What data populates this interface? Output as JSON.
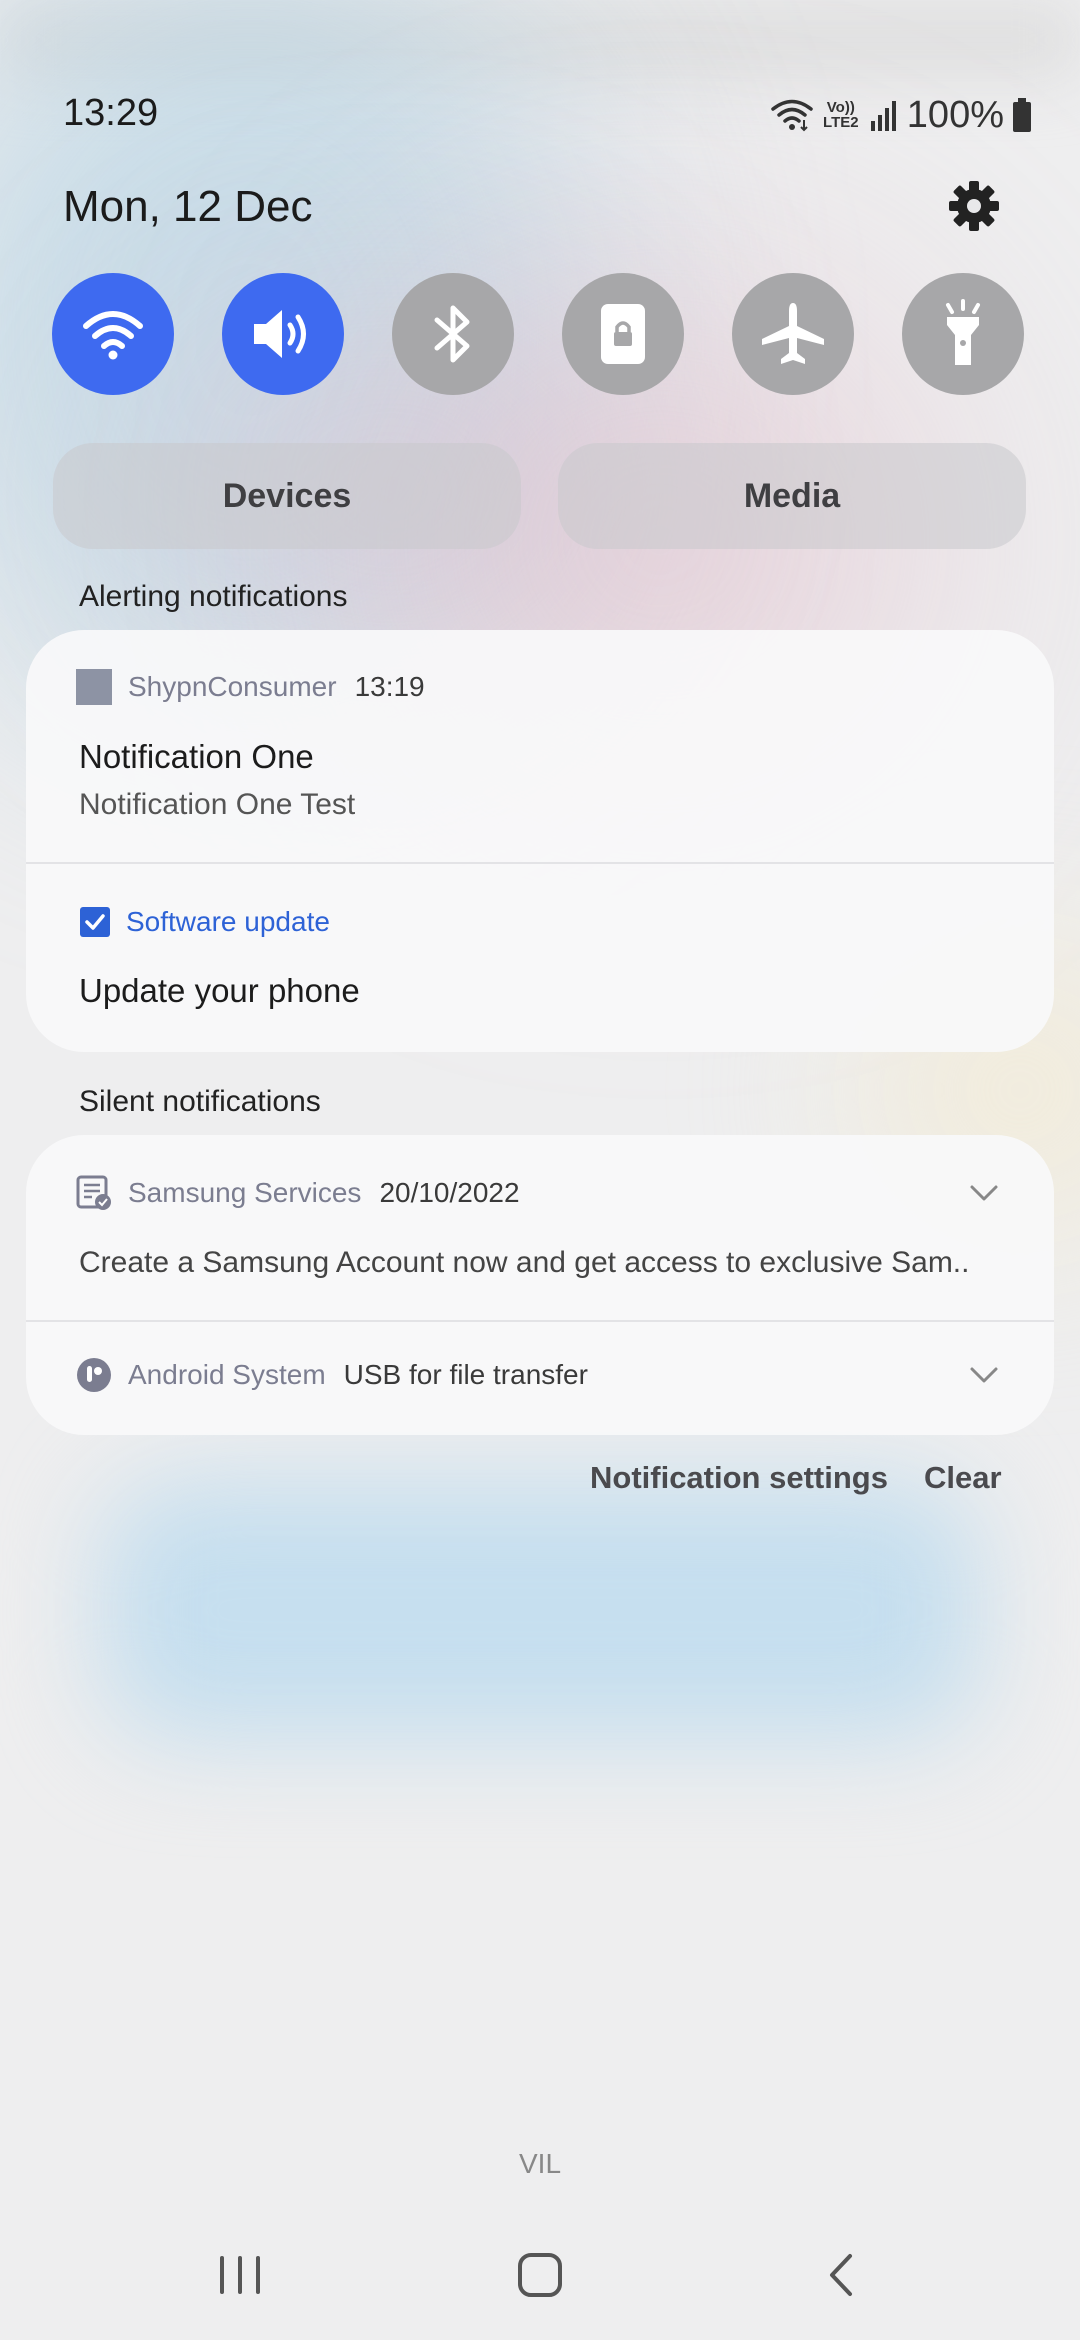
{
  "status_bar": {
    "time": "13:29",
    "battery": "100%",
    "volte_label": "Vo)) LTE2",
    "icons": [
      "wifi-icon",
      "volte-icon",
      "signal-bars-icon",
      "battery-icon"
    ]
  },
  "panel": {
    "date": "Mon, 12 Dec",
    "settings_icon": "gear-icon"
  },
  "quick_toggles": [
    {
      "name": "Wi-Fi",
      "icon": "wifi-icon",
      "state": "on"
    },
    {
      "name": "Sound",
      "icon": "volume-icon",
      "state": "on"
    },
    {
      "name": "Bluetooth",
      "icon": "bluetooth-icon",
      "state": "off"
    },
    {
      "name": "Portrait lock",
      "icon": "lock-icon",
      "state": "off"
    },
    {
      "name": "Airplane mode",
      "icon": "airplane-icon",
      "state": "off"
    },
    {
      "name": "Flashlight",
      "icon": "flashlight-icon",
      "state": "off"
    }
  ],
  "buttons": {
    "devices": "Devices",
    "media": "Media"
  },
  "alerting": {
    "section_label": "Alerting notifications",
    "items": [
      {
        "app": "ShypnConsumer",
        "time": "13:19",
        "title": "Notification One",
        "text": "Notification One Test"
      },
      {
        "app": "Software update",
        "title": "Update your phone"
      }
    ]
  },
  "silent": {
    "section_label": "Silent notifications",
    "items": [
      {
        "app": "Samsung Services",
        "time": "20/10/2022",
        "text": "Create a Samsung Account now and get access to exclusive Sam.."
      },
      {
        "app": "Android System",
        "text": "USB for file transfer"
      }
    ]
  },
  "actions": {
    "settings": "Notification settings",
    "clear": "Clear"
  },
  "carrier": "VIL",
  "colors": {
    "accent": "#3e6af0",
    "toggle_off": "#a7a7a9",
    "link_blue": "#2d62d6"
  }
}
